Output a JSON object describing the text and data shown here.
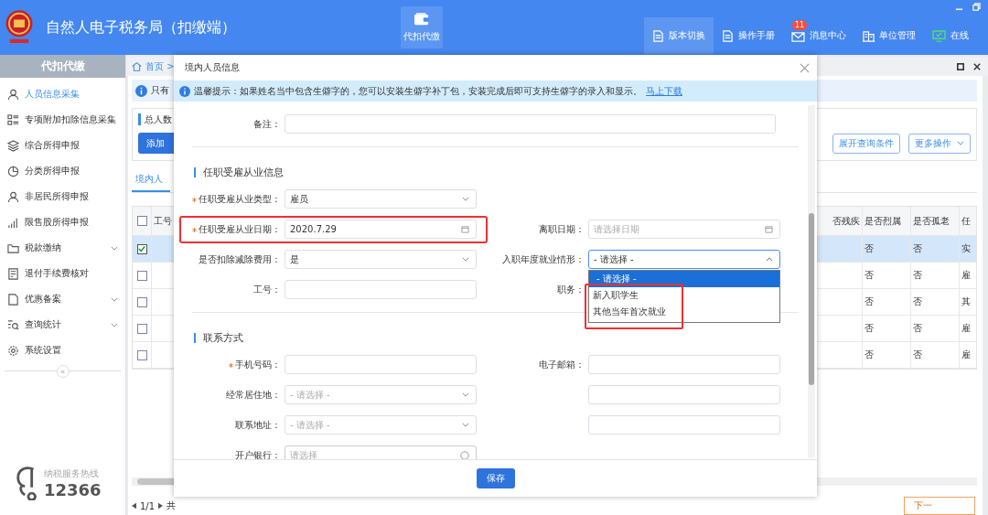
{
  "app": {
    "title": "自然人电子税务局（扣缴端）",
    "modules": [
      {
        "label": "代扣代缴",
        "selected": true
      }
    ],
    "toolbar": [
      {
        "label": "版本切换",
        "kind": "doc",
        "selected": true
      },
      {
        "label": "操作手册",
        "kind": "doc",
        "selected": false
      },
      {
        "label": "消息中心",
        "kind": "mail",
        "selected": false,
        "badge": "11"
      },
      {
        "label": "单位管理",
        "kind": "building",
        "selected": false
      },
      {
        "label": "在线",
        "kind": "online",
        "selected": false
      }
    ]
  },
  "sidebar": {
    "title": "代扣代缴",
    "items": [
      {
        "label": "人员信息采集",
        "kind": "person",
        "selected": true,
        "expandable": false
      },
      {
        "label": "专项附加扣除信息采集",
        "kind": "grid",
        "selected": false,
        "expandable": false
      },
      {
        "label": "综合所得申报",
        "kind": "layers",
        "selected": false,
        "expandable": false
      },
      {
        "label": "分类所得申报",
        "kind": "pie",
        "selected": false,
        "expandable": false
      },
      {
        "label": "非居民所得申报",
        "kind": "person",
        "selected": false,
        "expandable": false
      },
      {
        "label": "限售股所得申报",
        "kind": "bars",
        "selected": false,
        "expandable": false
      },
      {
        "label": "税款缴纳",
        "kind": "folder",
        "selected": false,
        "expandable": true
      },
      {
        "label": "退付手续费核对",
        "kind": "list",
        "selected": false,
        "expandable": false
      },
      {
        "label": "优惠备案",
        "kind": "doc",
        "selected": false,
        "expandable": true
      },
      {
        "label": "查询统计",
        "kind": "search",
        "selected": false,
        "expandable": true
      },
      {
        "label": "系统设置",
        "kind": "gear",
        "selected": false,
        "expandable": false
      }
    ],
    "collapse": "«",
    "hotline_label": "纳税服务热线",
    "hotline": "12366"
  },
  "breadcrumb": "首页 >",
  "notice": "只有",
  "summary": "总人数",
  "add_button": "添加",
  "actions": [
    {
      "label": "展开查询条件",
      "dropdown": false
    },
    {
      "label": "更多操作",
      "dropdown": true
    }
  ],
  "tab": "境内人",
  "table": {
    "all_checked": false,
    "columns_left": [
      "工号"
    ],
    "columns_right": [
      "否残疾",
      "是否烈属",
      "是否孤老",
      "任"
    ],
    "rows": [
      {
        "selected": true,
        "checked": true,
        "cells": [
          "否",
          "否",
          "实"
        ]
      },
      {
        "selected": false,
        "checked": false,
        "cells": [
          "否",
          "否",
          "雇"
        ]
      },
      {
        "selected": false,
        "checked": false,
        "cells": [
          "否",
          "否",
          "其"
        ]
      },
      {
        "selected": false,
        "checked": false,
        "cells": [
          "否",
          "否",
          "雇"
        ]
      },
      {
        "selected": false,
        "checked": false,
        "cells": [
          "否",
          "否",
          "雇"
        ]
      }
    ]
  },
  "pagination": {
    "page": "1/1",
    "total": "共"
  },
  "next_button": "下一",
  "dialog": {
    "title": "境内人员信息",
    "tip": "温馨提示：如果姓名当中包含生僻字的，您可以安装生僻字补丁包，安装完成后即可支持生僻字的录入和显示。",
    "tip_link": "马上下载",
    "remark": {
      "label": "备注："
    },
    "sections": [
      {
        "title": "任职受雇从业信息",
        "rows": [
          [
            {
              "label": "任职受雇从业类型：",
              "kind": "select",
              "value": "雇员",
              "required": true,
              "highlighted": false
            }
          ],
          [
            {
              "label": "任职受雇从业日期：",
              "kind": "date",
              "value": "2020.7.29",
              "required": true,
              "highlighted": true
            },
            {
              "label": "离职日期：",
              "kind": "date",
              "placeholder": "请选择日期",
              "required": false,
              "highlighted": false
            }
          ],
          [
            {
              "label": "是否扣除减除费用：",
              "kind": "select",
              "value": "是",
              "required": false,
              "highlighted": false
            },
            {
              "label": "入职年度就业情形：",
              "kind": "open-select",
              "value": "- 请选择 -",
              "required": false,
              "highlighted": false,
              "options": [
                {
                  "label": "- 请选择 -",
                  "selected": true,
                  "highlighted": false
                },
                {
                  "label": "新入职学生",
                  "selected": false,
                  "highlighted": true
                },
                {
                  "label": "其他当年首次就业",
                  "selected": false,
                  "highlighted": true
                }
              ]
            }
          ],
          [
            {
              "label": "工号：",
              "kind": "text",
              "required": false,
              "highlighted": false
            },
            {
              "label": "职务：",
              "kind": "hidden",
              "required": false,
              "highlighted": false
            }
          ]
        ]
      },
      {
        "title": "联系方式",
        "rows": [
          [
            {
              "label": "手机号码：",
              "kind": "text",
              "required": true,
              "highlighted": false
            },
            {
              "label": "电子邮箱：",
              "kind": "text",
              "required": false,
              "highlighted": false
            }
          ],
          [
            {
              "label": "经常居住地：",
              "kind": "select",
              "placeholder": "- 请选择 -",
              "required": false,
              "highlighted": false
            },
            {
              "kind": "text",
              "highlighted": false
            }
          ],
          [
            {
              "label": "联系地址：",
              "kind": "select",
              "placeholder": "- 请选择 -",
              "required": false,
              "highlighted": false
            },
            {
              "kind": "text",
              "highlighted": false
            }
          ],
          [
            {
              "label": "开户银行：",
              "kind": "search",
              "placeholder": "请选择",
              "required": false,
              "highlighted": false
            }
          ]
        ]
      }
    ],
    "save_button": "保存"
  }
}
